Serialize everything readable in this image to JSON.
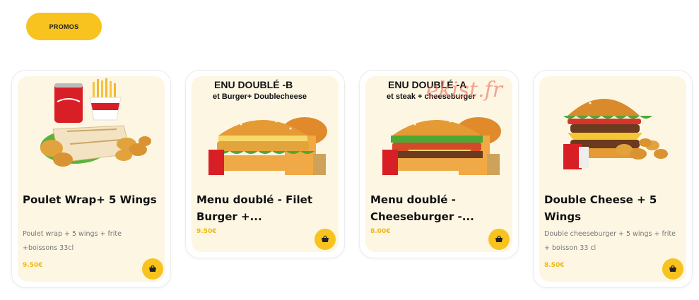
{
  "promo_button": {
    "label": "PROMOS"
  },
  "products": [
    {
      "title": "Poulet Wrap+ 5 Wings",
      "description": "Poulet wrap + 5 wings + frite +boissons 33cl",
      "price": "9.50€"
    },
    {
      "title": "Menu doublé - Filet Burger +...",
      "price": "9.50€",
      "ad_line1": "ENU DOUBLÉ -B",
      "ad_line2": "et Burger+ Doublecheese"
    },
    {
      "title": "Menu doublé - Cheeseburger -...",
      "price": "8.00€",
      "ad_line1": "ENU DOUBLÉ -A",
      "ad_line2": "et steak + cheeseburger",
      "watermark": "ekist.fr"
    },
    {
      "title": "Double Cheese + 5 Wings",
      "description": "Double cheeseburger + 5 wings + frite + boisson 33 cl",
      "price": "8.50€"
    }
  ],
  "icons": {
    "cart": "basket-icon"
  },
  "colors": {
    "accent": "#f8c31e",
    "card_bg": "#fdf6e3",
    "price": "#f0b818"
  }
}
